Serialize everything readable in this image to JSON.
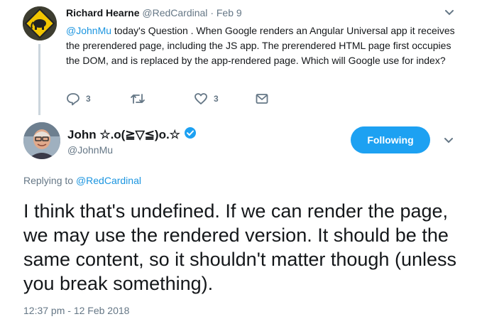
{
  "parent_tweet": {
    "name": "Richard Hearne",
    "handle": "@RedCardinal",
    "separator": "·",
    "date": "Feb 9",
    "mention": "@JohnMu",
    "text": " today's Question . When Google renders an Angular Universal app it receives the prerendered page, including the JS app. The prerendered HTML page first occupies the DOM, and is replaced by the app-rendered page. Which will Google use for index?",
    "actions": {
      "reply_icon": "reply-icon",
      "reply_count": "3",
      "retweet_icon": "retweet-icon",
      "like_icon": "heart-icon",
      "like_count": "3",
      "dm_icon": "envelope-icon"
    }
  },
  "main_tweet": {
    "name": "John ☆.o(≧▽≦)o.☆",
    "handle": "@JohnMu",
    "follow_label": "Following",
    "replying_prefix": "Replying to ",
    "replying_mention": "@RedCardinal",
    "text": "I think that's undefined. If we can render the page, we may use the rendered version. It should be the same content, so it shouldn't matter though (unless you break something).",
    "timestamp": "12:37 pm - 12 Feb 2018"
  },
  "colors": {
    "accent": "#1da1f2",
    "link": "#1b95e0",
    "muted": "#657786",
    "thread_line": "#ccd6dd"
  }
}
